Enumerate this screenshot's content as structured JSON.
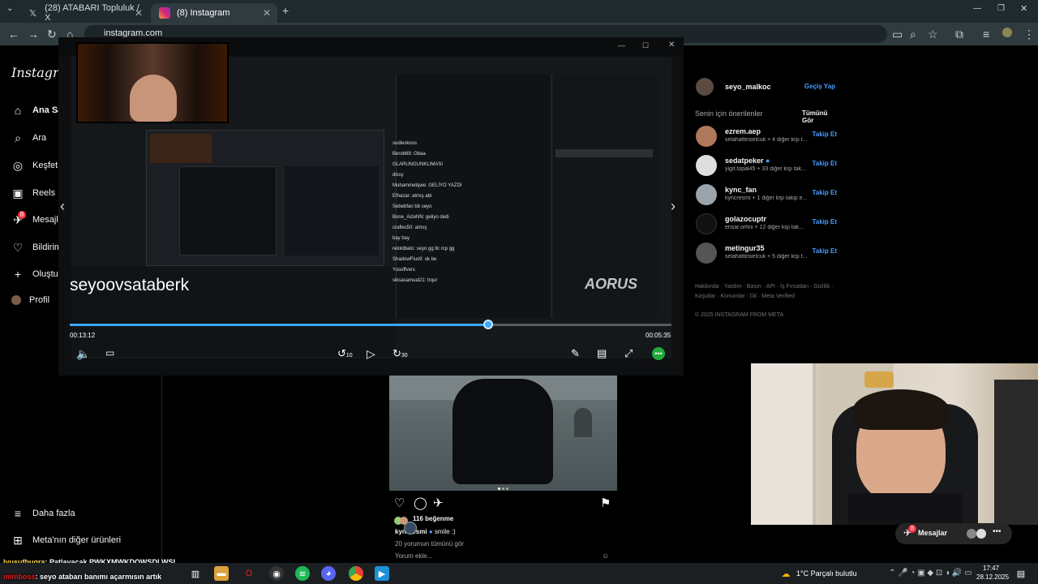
{
  "browser": {
    "tabs": [
      {
        "label": "(28) ATABARI Topluluk / X",
        "icon": "x-logo-icon"
      },
      {
        "label": "(8) Instagram",
        "icon": "instagram-icon",
        "active": true
      }
    ],
    "url": "instagram.com"
  },
  "ig_nav": {
    "logo": "Instagram",
    "items": [
      {
        "label": "Ana Sayfa",
        "icon": "home-icon"
      },
      {
        "label": "Ara",
        "icon": "search-icon"
      },
      {
        "label": "Keşfet",
        "icon": "compass-icon"
      },
      {
        "label": "Reels",
        "icon": "reels-icon"
      },
      {
        "label": "Mesajlar",
        "icon": "messages-icon",
        "badge": "8"
      },
      {
        "label": "Bildirimler",
        "icon": "heart-icon"
      },
      {
        "label": "Oluştur",
        "icon": "plus-icon"
      },
      {
        "label": "Profil",
        "icon": "avatar-icon"
      }
    ],
    "more": "Daha fazla",
    "meta": "Meta'nın diğer ürünleri"
  },
  "suggestions": {
    "current_user": "seyo_malkoc",
    "switch": "Geçiş Yap",
    "heading": "Senin için önerilenler",
    "see_all": "Tümünü Gör",
    "follow": "Takip Et",
    "list": [
      {
        "name": "ezrem.aep",
        "sub": "selahattinseIcuk + 4 diğer kişi t..."
      },
      {
        "name": "sedatpeker",
        "sub": "yigit.topal45 + 33 diğer kişi tak..."
      },
      {
        "name": "kync_fan",
        "sub": "kyncresmi + 1 diğer kişi takip e..."
      },
      {
        "name": "golazocuptr",
        "sub": "ensar.orhni + 12 diğer kişi tak..."
      },
      {
        "name": "metingur35",
        "sub": "selahattinseIcuk + 5 diğer kişi t..."
      }
    ],
    "footer1": "Hakkında · Yardım · Basın · API · İş Fırsatları · Gizlilik ·",
    "footer2": "Koşullar · Konumlar · Dil · Meta Verified",
    "copyright": "© 2025 INSTAGRAM FROM META"
  },
  "video": {
    "title": "seyoovsataberk",
    "current_time": "00:13:12",
    "duration": "00:05:35",
    "progress": 0.695,
    "skip_back": "10",
    "skip_fwd": "30",
    "chat_lines": [
      "sudleskoos",
      "Berob69: Obaa",
      "GLARUNGUNKLIMASI",
      "dissy",
      "Muhammetqwe: GELİYO YAZDI",
      "Efhazar: atmış abi",
      "Sebebfan bb seyo",
      "Bone_AizeNN: geliyo dedi",
      "crafles50: atmış",
      "bay bay",
      "reloldbato: seyo gg llc rcp gg",
      "ShadowFlux9: ok be",
      "Yusoffvers",
      "siksasamual21: trqur"
    ],
    "stream_brand": "AORUS"
  },
  "post": {
    "likes": "116 beğenme",
    "author": "kyncresmi",
    "caption": "smile :)",
    "comments": "20 yorumun tümünü gör",
    "add_comment": "Yorum ekle..."
  },
  "messages_pill": {
    "label": "Mesajlar",
    "badge": "8"
  },
  "chat_overlay": [
    {
      "user": "lyusufbugra",
      "text": ": Patlayacak PWKXMWKDOWSDLWSL"
    },
    {
      "user": "mimboss",
      "text": ": seyo atabarı banımı açarmısın artık"
    }
  ],
  "taskbar": {
    "weather": "1°C  Parçalı bulutlu",
    "time": "17:47",
    "date": "28.12.2025"
  }
}
